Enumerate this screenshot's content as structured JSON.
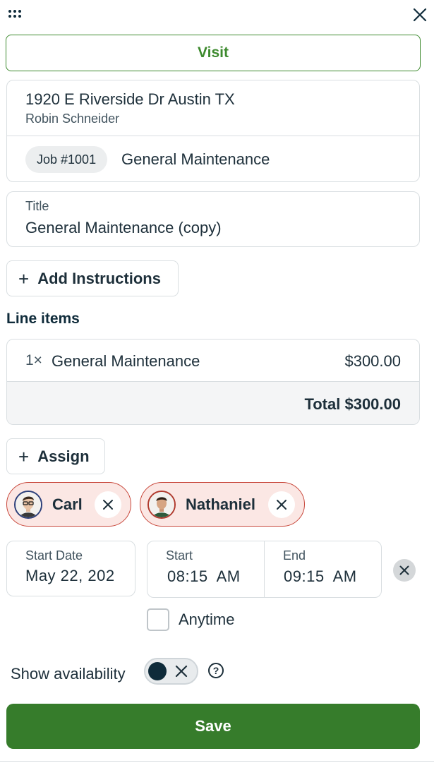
{
  "header": {
    "menu_icon": "grip-dots-icon",
    "close_icon": "close-icon",
    "visit_label": "Visit"
  },
  "property": {
    "address": "1920 E Riverside Dr Austin TX",
    "client": "Robin Schneider",
    "job_number": "Job #1001",
    "job_name": "General Maintenance"
  },
  "title_field": {
    "label": "Title",
    "value": "General Maintenance (copy)"
  },
  "add_instructions": {
    "icon": "plus-icon",
    "label": "Add Instructions"
  },
  "line_items": {
    "heading": "Line items",
    "items": [
      {
        "qty": "1×",
        "name": "General Maintenance",
        "price": "$300.00"
      }
    ],
    "total": "Total $300.00"
  },
  "assign": {
    "icon": "plus-icon",
    "label": "Assign"
  },
  "assignees": [
    {
      "name": "Carl",
      "avatar": "avatar-carl",
      "remove_icon": "close-icon"
    },
    {
      "name": "Nathaniel",
      "avatar": "avatar-nathaniel",
      "remove_icon": "close-icon"
    }
  ],
  "schedule": {
    "start_date_label": "Start Date",
    "start_date_value": "May 22, 202",
    "start_label": "Start",
    "start_value": "08:15  AM",
    "end_label": "End",
    "end_value": "09:15  AM",
    "clear_icon": "close-icon"
  },
  "anytime": {
    "label": "Anytime",
    "checked": false
  },
  "availability": {
    "label": "Show availability",
    "toggle_on": false,
    "help_icon": "help-icon"
  },
  "save_label": "Save",
  "colors": {
    "brand_green": "#367c2b",
    "visit_green": "#3d8a2e",
    "chip_bg": "#fbe7e4",
    "chip_border": "#c8473b",
    "text_dark": "#1d2f3a"
  }
}
